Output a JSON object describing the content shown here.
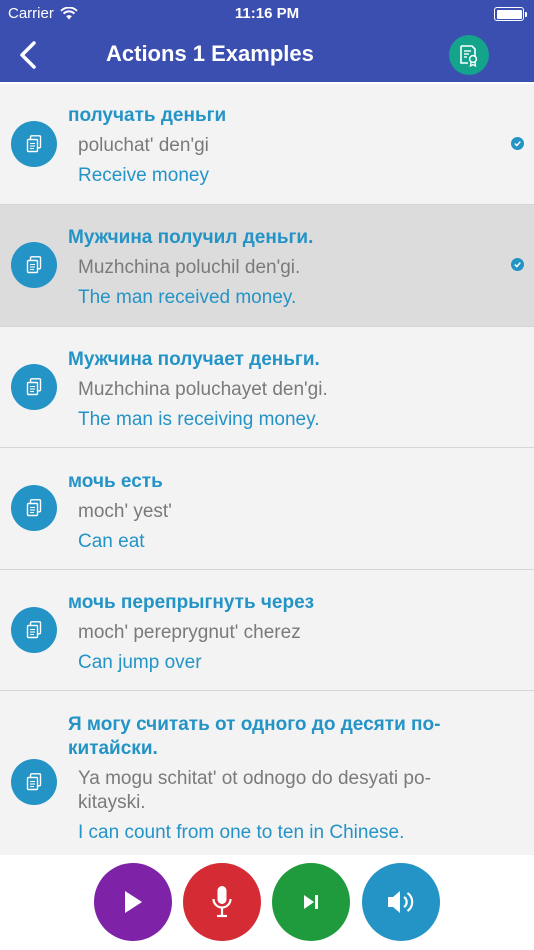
{
  "status_bar": {
    "carrier": "Carrier",
    "time": "11:16 PM"
  },
  "nav": {
    "title": "Actions 1 Examples",
    "back_icon": "chevron-left-icon",
    "certificate_icon": "certificate-icon"
  },
  "colors": {
    "header": "#3b4fb0",
    "accent": "#2493c6",
    "certificate": "#14a38b",
    "play": "#7e22a7",
    "mic": "#d42b34",
    "next": "#1f9b3d",
    "volume": "#2493c6"
  },
  "phrases": [
    {
      "native": "получать деньги",
      "translit": "poluchat' den'gi",
      "english": "Receive money",
      "checked": true,
      "selected": false
    },
    {
      "native": "Мужчина получил деньги.",
      "translit": "Muzhchina poluchil den'gi.",
      "english": "The man received money.",
      "checked": true,
      "selected": true
    },
    {
      "native": "Мужчина получает деньги.",
      "translit": "Muzhchina poluchayet den'gi.",
      "english": "The man is receiving money.",
      "checked": false,
      "selected": false
    },
    {
      "native": "мочь есть",
      "translit": "moch' yest'",
      "english": "Can eat",
      "checked": false,
      "selected": false
    },
    {
      "native": "мочь перепрыгнуть через",
      "translit": "moch' pereprygnut' cherez",
      "english": "Can jump over",
      "checked": false,
      "selected": false
    },
    {
      "native": "Я могу считать от одного до десяти по-китайски.",
      "translit": "Ya mogu schitat' ot odnogo do desyati po-kitayski.",
      "english": "I can count from one to ten in Chinese.",
      "checked": false,
      "selected": false
    }
  ],
  "controls": [
    "play-icon",
    "microphone-icon",
    "skip-next-icon",
    "speaker-icon"
  ]
}
